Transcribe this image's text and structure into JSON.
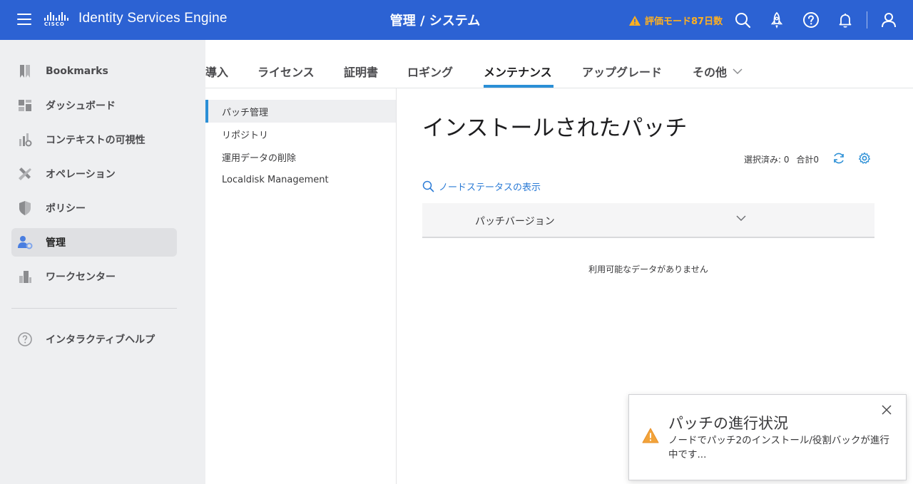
{
  "header": {
    "brand_logo_text": "CISCO",
    "app_title": "Identity Services Engine",
    "page_title": "管理 / システム",
    "eval_text": "評価モード87日数",
    "accent": "#2c62d3",
    "warning_color": "#ffb020"
  },
  "sidebar": {
    "items": [
      {
        "label": "Bookmarks",
        "icon": "bookmark-icon"
      },
      {
        "label": "ダッシュボード",
        "icon": "dashboard-icon"
      },
      {
        "label": "コンテキストの可視性",
        "icon": "visibility-icon"
      },
      {
        "label": "オペレーション",
        "icon": "tools-icon"
      },
      {
        "label": "ポリシー",
        "icon": "shield-icon"
      },
      {
        "label": "管理",
        "icon": "admin-icon",
        "active": true
      },
      {
        "label": "ワークセンター",
        "icon": "building-icon"
      }
    ],
    "help_label": "インタラクティブヘルプ"
  },
  "tabs": [
    {
      "label": "導入"
    },
    {
      "label": "ライセンス"
    },
    {
      "label": "証明書"
    },
    {
      "label": "ロギング"
    },
    {
      "label": "メンテナンス",
      "active": true
    },
    {
      "label": "アップグレード"
    },
    {
      "label": "その他"
    }
  ],
  "subnav": [
    {
      "label": "パッチ管理",
      "active": true
    },
    {
      "label": "リポジトリ"
    },
    {
      "label": "運用データの削除"
    },
    {
      "label": "Localdisk Management"
    }
  ],
  "main": {
    "title": "インストールされたパッチ",
    "selected_text": "選択済み: 0",
    "total_text": "合計0",
    "node_status_link": "ノードステータスの表示",
    "column_header": "パッチバージョン",
    "empty_text": "利用可能なデータがありません"
  },
  "toast": {
    "title": "パッチの進行状況",
    "message": "ノードでパッチ2のインストール/役割バックが進行中です..."
  }
}
